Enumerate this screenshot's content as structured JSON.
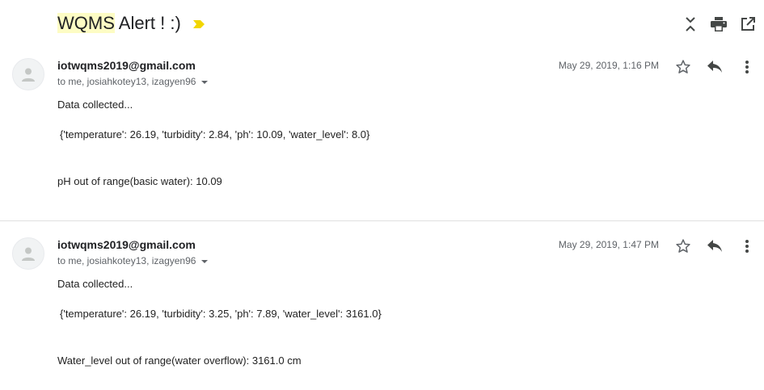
{
  "subject": {
    "highlight": "WQMS",
    "rest": " Alert ! :)"
  },
  "icons": {
    "importance": "importance-marker-icon",
    "collapse": "collapse-all-icon",
    "print": "print-icon",
    "open_new": "open-in-new-window-icon",
    "avatar": "person-icon",
    "star": "star-icon",
    "reply": "reply-icon",
    "more": "more-vert-icon",
    "caret": "caret-down-icon"
  },
  "colors": {
    "importance": "#f2d600",
    "subject_highlight": "#fdfcc4",
    "icon": "#5f6368",
    "icon_dark": "#444746"
  },
  "messages": [
    {
      "sender": "iotwqms2019@gmail.com",
      "recipients": "to me, josiahkotey13, izagyen96",
      "timestamp": "May 29, 2019, 1:16 PM",
      "body": [
        "Data collected...",
        "{'temperature': 26.19, 'turbidity': 2.84, 'ph': 10.09, 'water_level': 8.0}",
        "pH out of range(basic water): 10.09"
      ]
    },
    {
      "sender": "iotwqms2019@gmail.com",
      "recipients": "to me, josiahkotey13, izagyen96",
      "timestamp": "May 29, 2019, 1:47 PM",
      "body": [
        "Data collected...",
        "{'temperature': 26.19, 'turbidity': 3.25, 'ph': 7.89, 'water_level': 3161.0}",
        "Water_level out of range(water overflow): 3161.0 cm"
      ]
    }
  ]
}
